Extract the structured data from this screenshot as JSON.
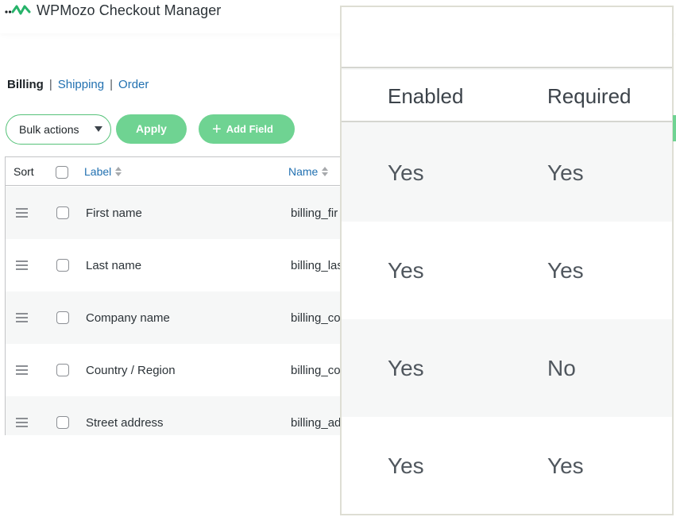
{
  "app": {
    "title": "WPMozo Checkout Manager"
  },
  "tabs": [
    {
      "label": "Billing",
      "active": true
    },
    {
      "label": "Shipping",
      "active": false
    },
    {
      "label": "Order",
      "active": false
    }
  ],
  "tab_separator": "|",
  "toolbar": {
    "bulk_actions_label": "Bulk actions",
    "apply_label": "Apply",
    "add_field_label": "Add Field"
  },
  "table": {
    "columns": {
      "sort": "Sort",
      "label": "Label",
      "name": "Name"
    },
    "rows": [
      {
        "label": "First name",
        "name": "billing_fir"
      },
      {
        "label": "Last name",
        "name": "billing_las"
      },
      {
        "label": "Company name",
        "name": "billing_co"
      },
      {
        "label": "Country / Region",
        "name": "billing_co"
      },
      {
        "label": "Street address",
        "name": "billing_ad"
      }
    ]
  },
  "zoom": {
    "columns": {
      "enabled": "Enabled",
      "required": "Required"
    },
    "rows": [
      {
        "enabled": "Yes",
        "required": "Yes"
      },
      {
        "enabled": "Yes",
        "required": "Yes"
      },
      {
        "enabled": "Yes",
        "required": "No"
      },
      {
        "enabled": "Yes",
        "required": "Yes"
      }
    ]
  },
  "colors": {
    "brand_green": "#6fd392",
    "link_blue": "#2271b1",
    "text_dark": "#1d2327"
  },
  "icons": {
    "logo": "wpmozo-logo-icon",
    "handle": "drag-handle-icon",
    "caret": "caret-down-icon",
    "plus": "plus-icon",
    "sort": "sort-arrows-icon"
  }
}
